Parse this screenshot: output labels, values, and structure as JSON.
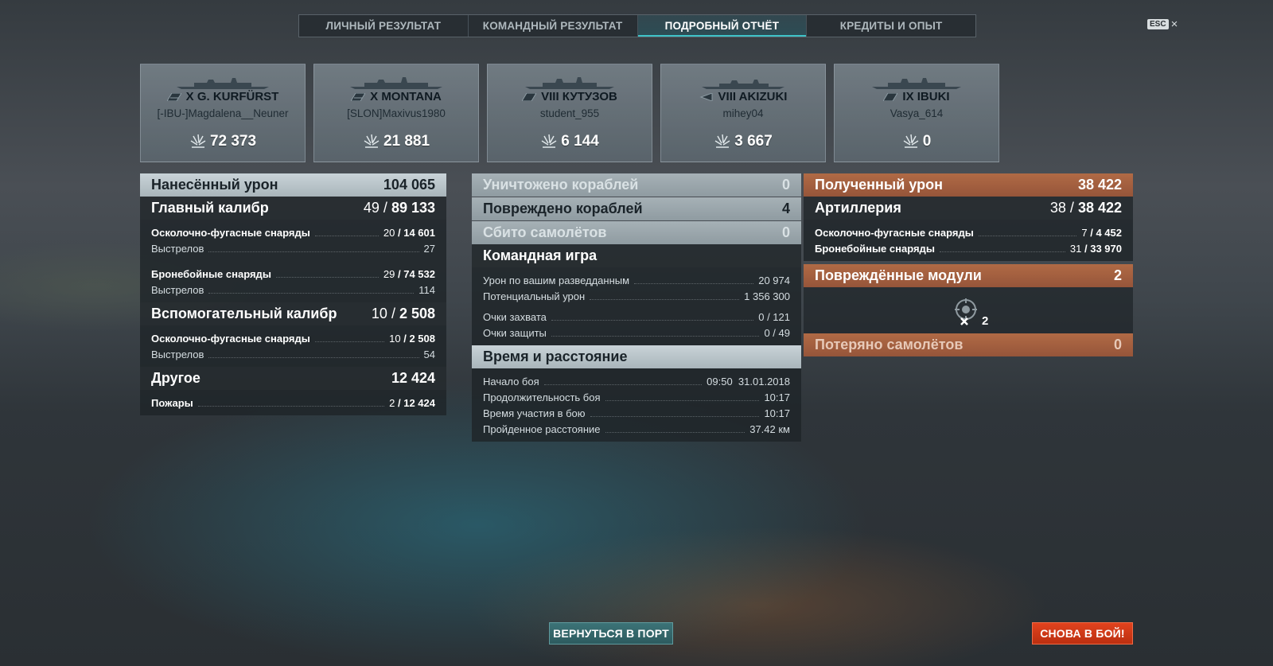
{
  "tabs": [
    {
      "label": "ЛИЧНЫЙ РЕЗУЛЬТАТ",
      "active": false
    },
    {
      "label": "КОМАНДНЫЙ РЕЗУЛЬТАТ",
      "active": false
    },
    {
      "label": "ПОДРОБНЫЙ ОТЧЁТ",
      "active": true
    },
    {
      "label": "КРЕДИТЫ И ОПЫТ",
      "active": false
    }
  ],
  "esc": {
    "key": "ESC",
    "close": "×"
  },
  "cards": [
    {
      "ship": "X G. KURFÜRST",
      "player": "[-IBU-]Magdalena__Neuner",
      "damage": "72 373"
    },
    {
      "ship": "X MONTANA",
      "player": "[SLON]Maxivus1980",
      "damage": "21 881"
    },
    {
      "ship": "VIII КУТУЗОВ",
      "player": "student_955",
      "damage": "6 144"
    },
    {
      "ship": "VIII AKIZUKI",
      "player": "mihey04",
      "damage": "3 667"
    },
    {
      "ship": "IX IBUKI",
      "player": "Vasya_614",
      "damage": "0"
    }
  ],
  "left": {
    "damage_dealt": {
      "label": "Нанесённый урон",
      "value": "104 065"
    },
    "main_battery": {
      "label": "Главный калибр",
      "hits": "49",
      "value": "89 133"
    },
    "main_he": {
      "label": "Осколочно-фугасные снаряды",
      "hits": "20",
      "value": "14 601"
    },
    "main_he_shots": {
      "label": "Выстрелов",
      "value": "27"
    },
    "main_ap": {
      "label": "Бронебойные снаряды",
      "hits": "29",
      "value": "74 532"
    },
    "main_ap_shots": {
      "label": "Выстрелов",
      "value": "114"
    },
    "secondary": {
      "label": "Вспомогательный калибр",
      "hits": "10",
      "value": "2 508"
    },
    "sec_he": {
      "label": "Осколочно-фугасные снаряды",
      "hits": "10",
      "value": "2 508"
    },
    "sec_shots": {
      "label": "Выстрелов",
      "value": "54"
    },
    "other": {
      "label": "Другое",
      "value": "12 424"
    },
    "fires": {
      "label": "Пожары",
      "hits": "2",
      "value": "12 424"
    }
  },
  "middle": {
    "destroyed": {
      "label": "Уничтожено кораблей",
      "value": "0"
    },
    "damaged": {
      "label": "Повреждено кораблей",
      "value": "4"
    },
    "planes": {
      "label": "Сбито самолётов",
      "value": "0"
    },
    "team": {
      "label": "Командная игра"
    },
    "spotting": {
      "label": "Урон по вашим разведданным",
      "value": "20 974"
    },
    "potential": {
      "label": "Потенциальный урон",
      "value": "1 356 300"
    },
    "capture": {
      "label": "Очки захвата",
      "value": "0 / 121"
    },
    "defense": {
      "label": "Очки защиты",
      "value": "0 / 49"
    },
    "time": {
      "label": "Время и расстояние"
    },
    "start": {
      "label": "Начало боя",
      "value": "09:50  31.01.2018"
    },
    "duration": {
      "label": "Продолжительность боя",
      "value": "10:17"
    },
    "participation": {
      "label": "Время участия в бою",
      "value": "10:17"
    },
    "distance": {
      "label": "Пройденное расстояние",
      "value": "37.42 км"
    }
  },
  "right": {
    "received": {
      "label": "Полученный урон",
      "value": "38 422"
    },
    "artillery": {
      "label": "Артиллерия",
      "hits": "38",
      "value": "38 422"
    },
    "he": {
      "label": "Осколочно-фугасные снаряды",
      "hits": "7",
      "value": "4 452"
    },
    "ap": {
      "label": "Бронебойные снаряды",
      "hits": "31",
      "value": "33 970"
    },
    "modules": {
      "label": "Повреждённые модули",
      "value": "2",
      "icon_count": "2"
    },
    "planes_lost": {
      "label": "Потеряно самолётов",
      "value": "0"
    }
  },
  "buttons": {
    "port": "ВЕРНУТЬСЯ В ПОРТ",
    "battle": "СНОВА В БОЙ!"
  },
  "colors": {
    "accent": "#3ec2c7",
    "orange": "#b06a45",
    "battle": "#e2431e"
  }
}
